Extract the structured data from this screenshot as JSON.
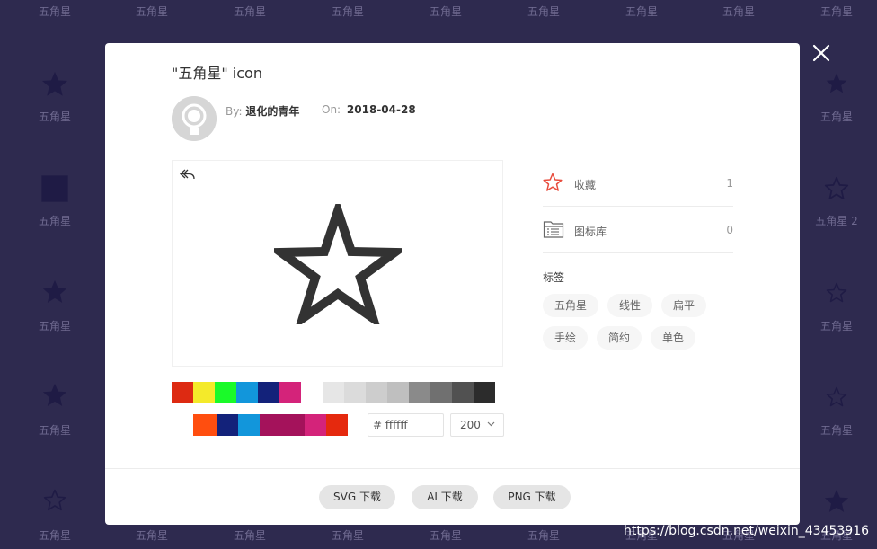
{
  "background": {
    "label_default": "五角星",
    "label_alt": "五角星 2",
    "colors": {
      "backdrop": "#2e2a4f",
      "label": "#6f6a90",
      "icon": "#1f1b45"
    }
  },
  "modal": {
    "title": "\"五角星\" icon",
    "author_key": "By:",
    "author_name": "退化的青年",
    "date_key": "On:",
    "date_value": "2018-04-28",
    "hex_prefix": "#",
    "hex_value": "ffffff",
    "size_value": "200",
    "favorite": {
      "label": "收藏",
      "count": "1",
      "icon": "star-outline-icon",
      "color": "#e84c3d"
    },
    "library": {
      "label": "图标库",
      "count": "0",
      "icon": "folder-list-icon"
    },
    "tags_title": "标签",
    "tags": [
      "五角星",
      "线性",
      "扁平",
      "手绘",
      "简约",
      "单色"
    ],
    "palette_row1": [
      "#dd2a12",
      "#f4ea2a",
      "#1afa29",
      "#1296db",
      "#13227a",
      "#d4237a",
      "#ffffff",
      "#e6e6e6",
      "#dbdbdb",
      "#cdcdcd",
      "#bfbfbf",
      "#8a8a8a",
      "#707070",
      "#515151",
      "#2c2c2c"
    ],
    "palette_row2": [
      "#ffffff",
      "#ff4e0f",
      "#13227a",
      "#1296db",
      "#a4125b",
      "#a4125b",
      "#d4237a",
      "#e5290e"
    ],
    "downloads": [
      "SVG 下载",
      "AI 下载",
      "PNG 下载"
    ]
  },
  "watermark": "https://blog.csdn.net/weixin_43453916"
}
